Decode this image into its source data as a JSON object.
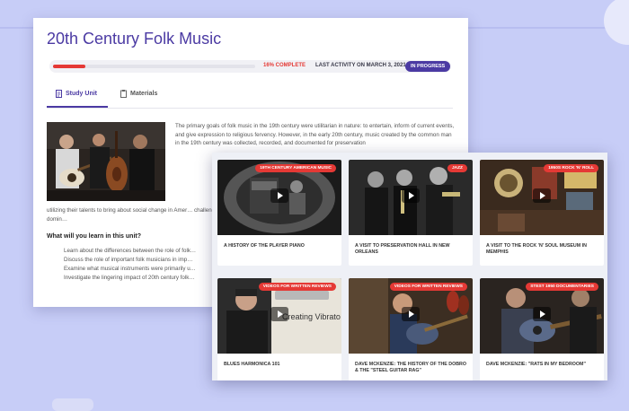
{
  "course": {
    "title": "20th Century Folk Music",
    "progress_percent": 16,
    "progress_label": "16% COMPLETE",
    "last_activity": "LAST ACTIVITY ON MARCH 3, 2021",
    "status": "IN PROGRESS"
  },
  "tabs": [
    {
      "label": "Study Unit",
      "active": true,
      "icon": "document-icon"
    },
    {
      "label": "Materials",
      "active": false,
      "icon": "clipboard-icon"
    }
  ],
  "unit": {
    "intro_paragraph": "The primary goals of folk music in the 19th century were utilitarian in nature: to entertain, inform of current events, and give expression to religious fervency. However, in the early 20th century, music created by the common man in the 19th century was collected, recorded, and documented for preservation",
    "continuation": "utilizing their talents to bring about social change in Amer… challenge of folk musicians until folk music lost its domin…",
    "learn_heading": "What will you learn in this unit?",
    "objectives": [
      "Learn about the differences between the role of folk…",
      "Discuss the role of important folk musicians in imp…",
      "Examine what musical instruments were primarily u…",
      "Investigate the lingering impact of 20th century folk…"
    ]
  },
  "videos": [
    {
      "tag": "19TH CENTURY AMERICAN MUSIC",
      "title": "A HISTORY OF THE PLAYER PIANO"
    },
    {
      "tag": "JAZZ",
      "title": "A VISIT TO PRESERVATION HALL IN NEW ORLEANS"
    },
    {
      "tag": "1950S ROCK 'N' ROLL",
      "title": "A VISIT TO THE ROCK 'N' SOUL MUSEUM IN MEMPHIS"
    },
    {
      "tag": "VIDEOS FOR WRITTEN REVIEWS",
      "title": "BLUES HARMONICA 101"
    },
    {
      "tag": "VIDEOS FOR WRITTEN REVIEWS",
      "title": "DAVE MCKENZIE: THE HISTORY OF THE DOBRO & THE \"STEEL GUITAR RAG\""
    },
    {
      "tag": "STEST 1950 DOCUMENTARIES",
      "title": "DAVE MCKENZIE: \"RATS IN MY BEDROOM\""
    }
  ],
  "thumbnail_text": {
    "harmonica": "Creating Vibrato"
  },
  "colors": {
    "accent": "#4b3aa3",
    "progress": "#e53935",
    "tag": "#e53935",
    "background": "#c7cdf7"
  }
}
